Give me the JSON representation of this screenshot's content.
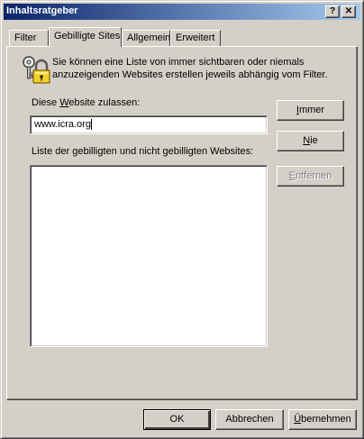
{
  "window": {
    "title": "Inhaltsratgeber",
    "help_glyph": "?",
    "close_glyph": "✕"
  },
  "tabs": [
    {
      "label": "Filter"
    },
    {
      "label": "Gebilligte Sites",
      "active": true
    },
    {
      "label": "Allgemein"
    },
    {
      "label": "Erweitert"
    }
  ],
  "panel": {
    "icon": "key-lock-icon",
    "description": "Sie können eine Liste von immer sichtbaren oder niemals anzuzeigenden Websites erstellen jeweils abhängig vom Filter.",
    "website_label_pre": "Diese ",
    "website_label_mnemonic": "W",
    "website_label_post": "ebsite zulassen:",
    "website_value": "www.icra.org",
    "list_label": "Liste der gebilligten und nicht gebilligten Websites:",
    "list_items": [],
    "buttons": {
      "always_mnemonic": "I",
      "always_rest": "mmer",
      "never_mnemonic": "N",
      "never_rest": "ie",
      "remove_mnemonic": "E",
      "remove_rest": "ntfernen"
    }
  },
  "footer": {
    "ok": "OK",
    "cancel": "Abbrechen",
    "apply_mnemonic": "Ü",
    "apply_rest": "bernehmen"
  }
}
